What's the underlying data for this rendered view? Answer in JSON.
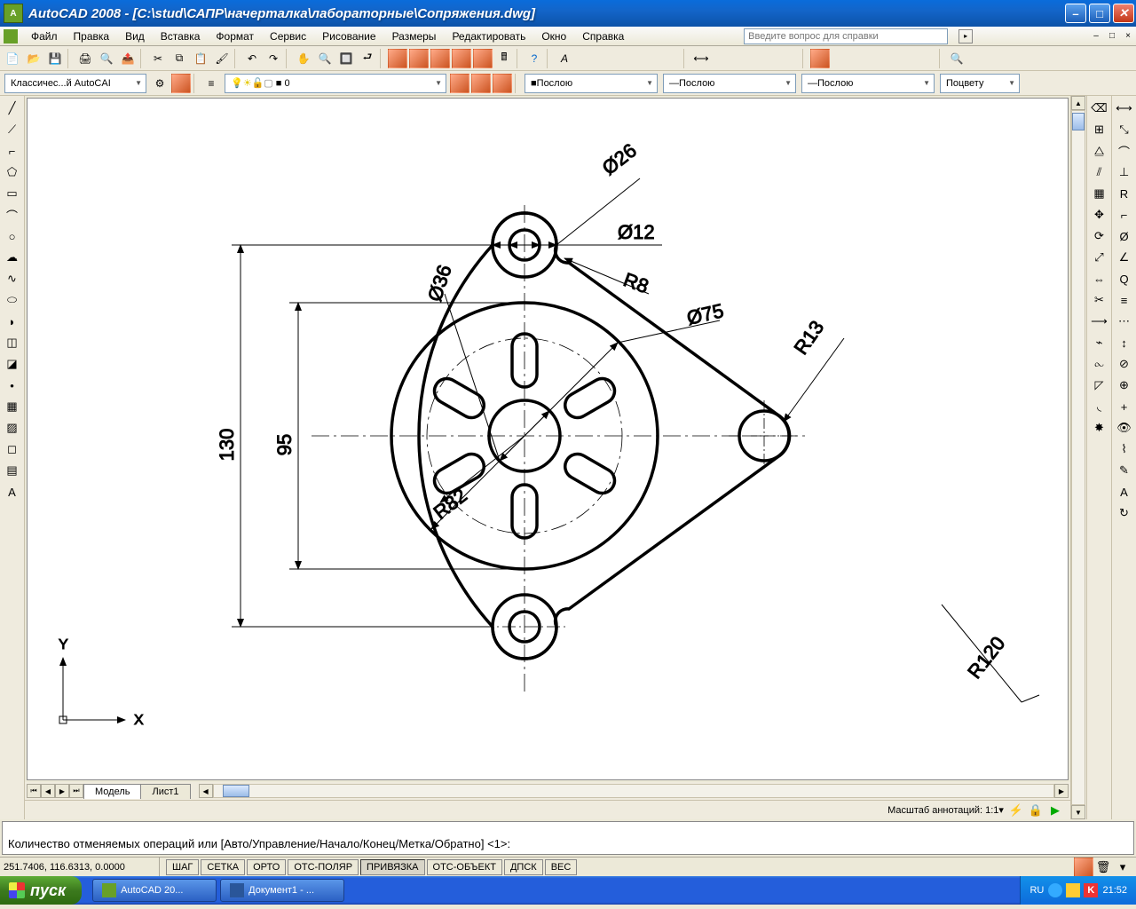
{
  "titlebar": {
    "app": "AutoCAD 2008",
    "file": "[C:\\stud\\САПР\\начерталка\\лабораторные\\Сопряжения.dwg]"
  },
  "menu": [
    "Файл",
    "Правка",
    "Вид",
    "Вставка",
    "Формат",
    "Сервис",
    "Рисование",
    "Размеры",
    "Редактировать",
    "Окно",
    "Справка"
  ],
  "help_placeholder": "Введите вопрос для справки",
  "toolbar2": {
    "workspace_drop": "Классичес...й AutoCAI",
    "layer_drop": "0",
    "linetype1": "Послою",
    "lineweight": "Послою",
    "linetype2": "Послою",
    "color": "Поцвету"
  },
  "tabs": {
    "model": "Модель",
    "sheet": "Лист1"
  },
  "anno": {
    "label": "Масштаб аннотаций:",
    "scale": "1:1"
  },
  "cmd": "Количество отменяемых операций или [Авто/Управление/Начало/Конец/Метка/Обратно] <1>:",
  "status": {
    "coords": "251.7406, 116.6313, 0.0000",
    "buttons": [
      "ШАГ",
      "СЕТКА",
      "ОРТО",
      "ОТС-ПОЛЯР",
      "ПРИВЯЗКА",
      "ОТС-ОБЪЕКТ",
      "ДПСК",
      "ВЕС"
    ],
    "active_idx": 4,
    "lang": "RU",
    "clock": "21:52"
  },
  "taskbar": {
    "start": "пуск",
    "tasks": [
      "AutoCAD 20...",
      "Документ1 - ..."
    ]
  },
  "drawing": {
    "dims": {
      "d26": "Ø26",
      "d12": "Ø12",
      "d36": "Ø36",
      "d75": "Ø75",
      "r8": "R8",
      "r13": "R13",
      "r82": "R82",
      "r120": "R120",
      "h130": "130",
      "h95": "95"
    },
    "ucs": {
      "x": "X",
      "y": "Y"
    }
  }
}
